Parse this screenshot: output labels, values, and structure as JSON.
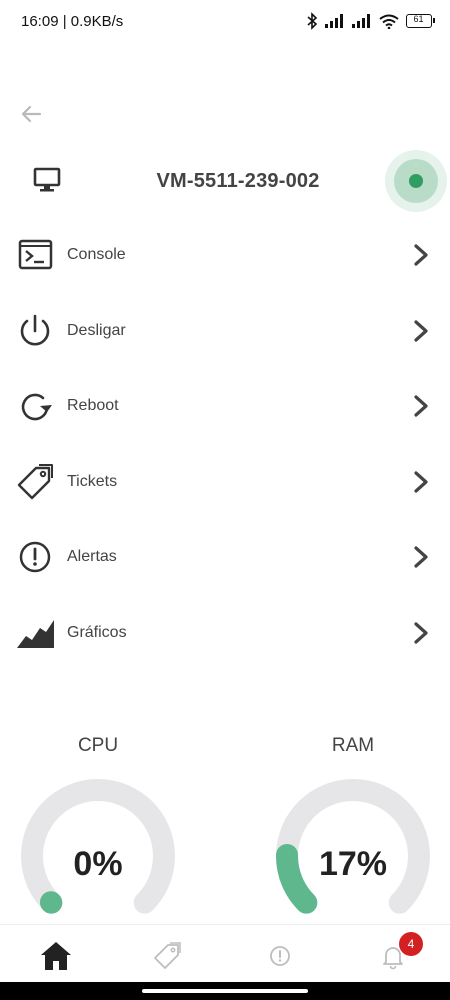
{
  "status_bar": {
    "time_speed": "16:09 | 0.9KB/s",
    "battery": "61"
  },
  "header": {
    "vm_name": "VM-5511-239-002",
    "status": "online",
    "status_color": "#2f9e62"
  },
  "menu": {
    "items": [
      {
        "label": "Console",
        "icon": "terminal-icon"
      },
      {
        "label": "Desligar",
        "icon": "power-icon"
      },
      {
        "label": "Reboot",
        "icon": "reboot-icon"
      },
      {
        "label": "Tickets",
        "icon": "ticket-icon"
      },
      {
        "label": "Alertas",
        "icon": "alert-icon"
      },
      {
        "label": "Gráficos",
        "icon": "area-chart-icon"
      }
    ]
  },
  "gauges": {
    "cpu": {
      "title": "CPU",
      "value_text": "0%",
      "percent": 0
    },
    "ram": {
      "title": "RAM",
      "value_text": "17%",
      "percent": 17
    },
    "accent_color": "#5fb78d",
    "track_color": "#e6e6e8"
  },
  "bottom_nav": {
    "items": [
      "home-icon",
      "ticket-icon",
      "alert-icon",
      "bell-icon"
    ],
    "notification_count": "4",
    "badge_color": "#d32023"
  }
}
